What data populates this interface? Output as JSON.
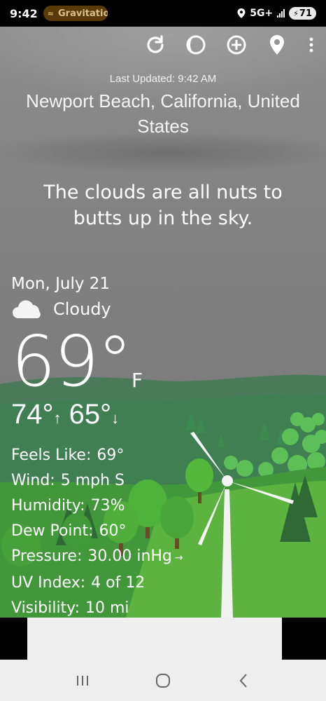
{
  "status_bar": {
    "time": "9:42",
    "notification_app": "Gravitatio",
    "network": "5G+",
    "battery": "71"
  },
  "toolbar": {
    "icons": [
      "refresh-icon",
      "moon-phase-icon",
      "add-location-icon",
      "location-pin-icon",
      "more-options-icon"
    ]
  },
  "header": {
    "last_updated": "Last Updated: 9:42 AM",
    "location": "Newport Beach, California, United States"
  },
  "tagline": "The clouds are all nuts to butts up in the sky.",
  "current": {
    "date": "Mon, July 21",
    "condition": "Cloudy",
    "temperature": "69°",
    "unit": "F",
    "high": "74°",
    "low": "65°"
  },
  "details": [
    {
      "label": "Feels Like:",
      "value": "69°"
    },
    {
      "label": "Wind:",
      "value": "5 mph S"
    },
    {
      "label": "Humidity:",
      "value": "73%"
    },
    {
      "label": "Dew Point:",
      "value": "60°"
    },
    {
      "label": "Pressure:",
      "value": "30.00 inHg"
    },
    {
      "label": "UV Index:",
      "value": "4 of 12"
    },
    {
      "label": "Visibility:",
      "value": "10 mi"
    }
  ],
  "colors": {
    "sky": "#7e7e7e",
    "hills": "#3e8a4e",
    "grass": "#3f9a3a",
    "tree": "#58b83a"
  }
}
